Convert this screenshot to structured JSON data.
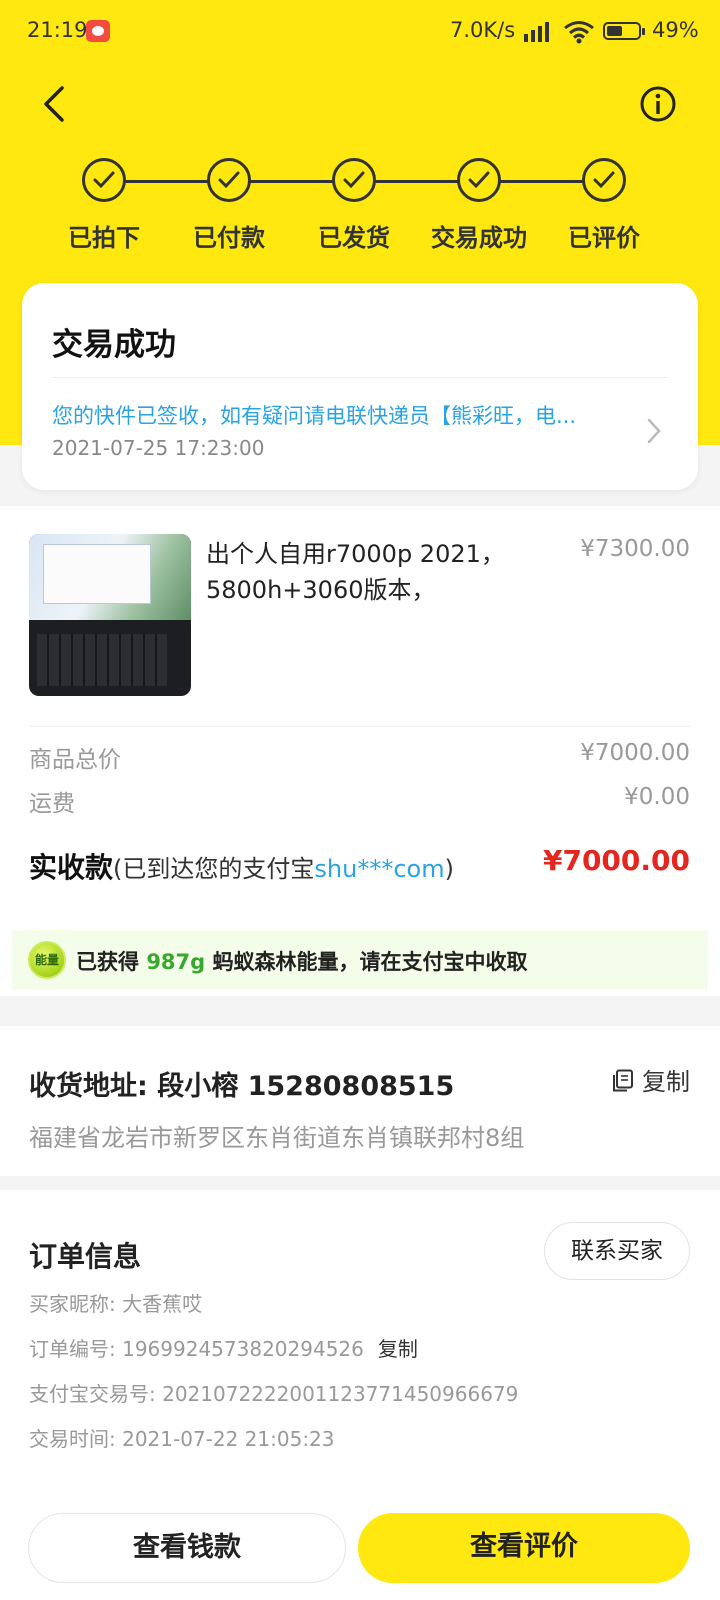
{
  "status_bar": {
    "time": "21:19",
    "network_speed": "7.0K/s",
    "battery": "49%"
  },
  "header": {
    "back_icon": "chevron-left-icon",
    "info_icon": "info-circle-icon",
    "accent": "#ffe80f"
  },
  "steps": [
    {
      "label": "已拍下"
    },
    {
      "label": "已付款"
    },
    {
      "label": "已发货"
    },
    {
      "label": "交易成功"
    },
    {
      "label": "已评价"
    }
  ],
  "status_card": {
    "title": "交易成功",
    "message": "您的快件已签收，如有疑问请电联快递员【熊彩旺，电...",
    "datetime": "2021-07-25 17:23:00"
  },
  "product": {
    "name": "出个人自用r7000p 2021，5800h+3060版本，",
    "price": "¥7300.00"
  },
  "pricing": {
    "goods_total_label": "商品总价",
    "goods_total": "¥7000.00",
    "shipping_label": "运费",
    "shipping": "¥0.00",
    "received_label": "实收款",
    "received_note_prefix": "(已到达您的支付宝",
    "alipay_account": "shu***com",
    "received_note_suffix": ")",
    "received_amount": "¥7000.00"
  },
  "energy": {
    "badge": "能量",
    "prefix": "已获得",
    "amount": "987g",
    "suffix": "蚂蚁森林能量，请在支付宝中收取"
  },
  "address": {
    "header": "收货地址:  段小榕  15280808515",
    "copy_label": "复制",
    "full": "福建省龙岩市新罗区东肖街道东肖镇联邦村8组"
  },
  "order_info": {
    "title": "订单信息",
    "contact_button": "联系买家",
    "buyer_nickname": "买家昵称: 大香蕉哎",
    "order_number": "订单编号: 1969924573820294526",
    "order_copy": "复制",
    "alipay_trade_no": "支付宝交易号: 2021072222001123771450966679",
    "trade_time": "交易时间: 2021-07-22 21:05:23"
  },
  "actions": {
    "view_money": "查看钱款",
    "view_review": "查看评价"
  }
}
